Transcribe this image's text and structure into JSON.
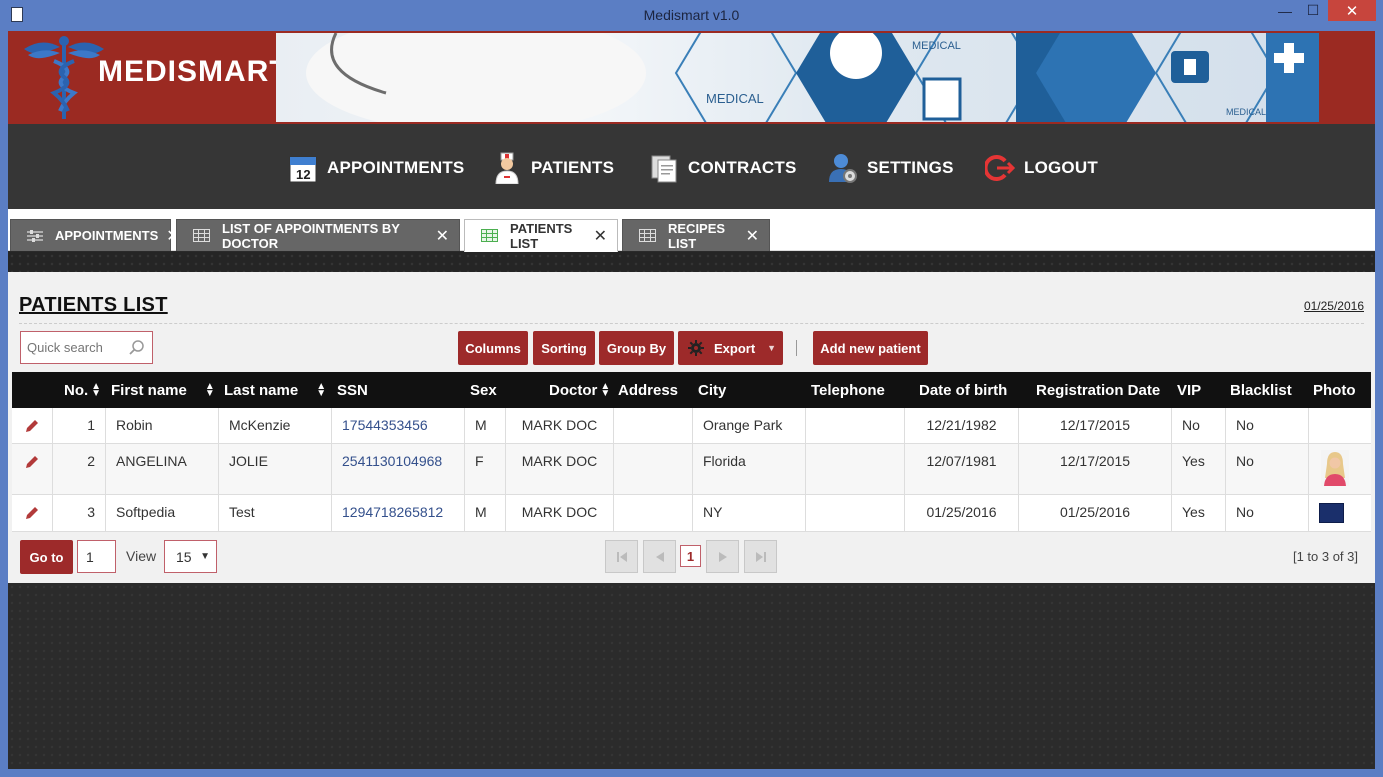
{
  "window": {
    "title": "Medismart v1.0",
    "min": "—",
    "max": "☐",
    "close": "✕"
  },
  "brand": {
    "name": "MEDISMART"
  },
  "nav": [
    {
      "label": "APPOINTMENTS",
      "icon": "calendar-icon",
      "badge": "12"
    },
    {
      "label": "PATIENTS",
      "icon": "nurse-icon"
    },
    {
      "label": "CONTRACTS",
      "icon": "documents-icon"
    },
    {
      "label": "SETTINGS",
      "icon": "user-gear-icon"
    },
    {
      "label": "LOGOUT",
      "icon": "logout-icon"
    }
  ],
  "tabs": [
    {
      "label": "APPOINTMENTS",
      "icon": "sliders-icon",
      "active": false
    },
    {
      "label": "LIST OF APPOINTMENTS BY DOCTOR",
      "icon": "grid-icon",
      "active": false
    },
    {
      "label": "PATIENTS LIST",
      "icon": "grid-icon",
      "active": true
    },
    {
      "label": "RECIPES LIST",
      "icon": "grid-icon",
      "active": false
    }
  ],
  "tab_close": "✕",
  "page": {
    "title": "PATIENTS LIST",
    "date": "01/25/2016"
  },
  "search": {
    "placeholder": "Quick search"
  },
  "toolbar": {
    "columns": "Columns",
    "sorting": "Sorting",
    "group_by": "Group By",
    "export": "Export",
    "add_patient": "Add new patient"
  },
  "table": {
    "headers": {
      "no": "No.",
      "first_name": "First name",
      "last_name": "Last name",
      "ssn": "SSN",
      "sex": "Sex",
      "doctor": "Doctor",
      "address": "Address",
      "city": "City",
      "telephone": "Telephone",
      "dob": "Date of birth",
      "reg_date": "Registration Date",
      "vip": "VIP",
      "blacklist": "Blacklist",
      "photo": "Photo"
    },
    "rows": [
      {
        "no": "1",
        "first_name": "Robin",
        "last_name": "McKenzie",
        "ssn": "17544353456",
        "sex": "M",
        "doctor": "MARK DOC",
        "address": "",
        "city": "Orange Park",
        "telephone": "",
        "dob": "12/21/1982",
        "reg_date": "12/17/2015",
        "vip": "No",
        "blacklist": "No"
      },
      {
        "no": "2",
        "first_name": "ANGELINA",
        "last_name": "JOLIE",
        "ssn": "2541130104968",
        "sex": "F",
        "doctor": "MARK DOC",
        "address": "",
        "city": "Florida",
        "telephone": "",
        "dob": "12/07/1981",
        "reg_date": "12/17/2015",
        "vip": "Yes",
        "blacklist": "No"
      },
      {
        "no": "3",
        "first_name": "Softpedia",
        "last_name": "Test",
        "ssn": "1294718265812",
        "sex": "M",
        "doctor": "MARK DOC",
        "address": "",
        "city": "NY",
        "telephone": "",
        "dob": "01/25/2016",
        "reg_date": "01/25/2016",
        "vip": "Yes",
        "blacklist": "No"
      }
    ]
  },
  "pagination": {
    "goto_label": "Go to",
    "page_value": "1",
    "view_label": "View",
    "page_size": "15",
    "current_page": "1",
    "range": "[1 to 3 of 3]"
  },
  "colors": {
    "accent": "#9d2a2a",
    "header": "#111111",
    "nav": "#363636",
    "window": "#5b7ec4"
  }
}
